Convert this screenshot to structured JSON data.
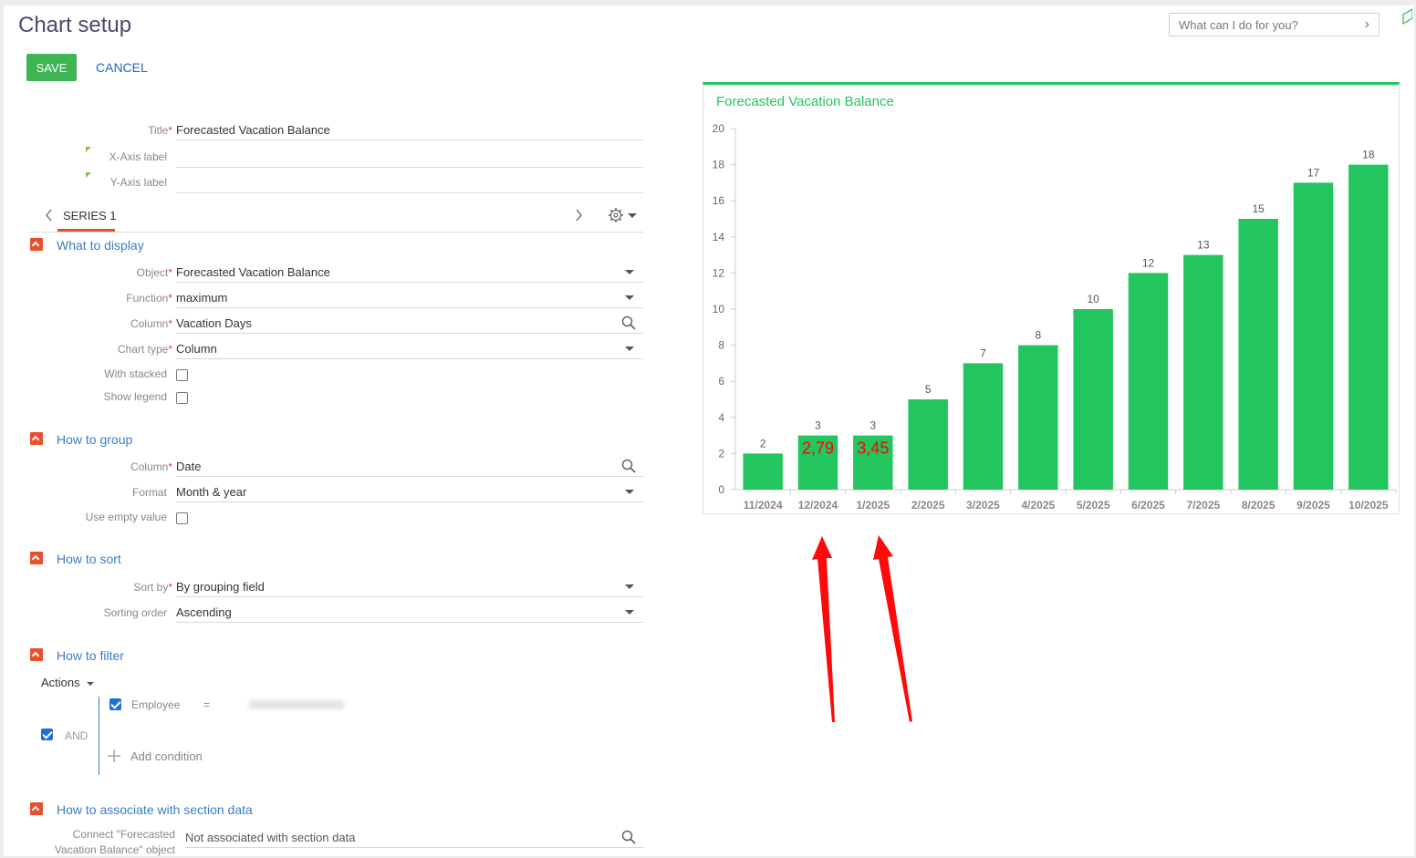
{
  "header": {
    "title": "Chart setup",
    "save_label": "SAVE",
    "cancel_label": "CANCEL",
    "assistant_placeholder": "What can I do for you?"
  },
  "form": {
    "title": {
      "label": "Title",
      "value": "Forecasted Vacation Balance"
    },
    "x_axis": {
      "label": "X-Axis label",
      "value": ""
    },
    "y_axis": {
      "label": "Y-Axis label",
      "value": ""
    },
    "series_tab": "SERIES 1"
  },
  "sections": {
    "display": {
      "title": "What to display",
      "object": {
        "label": "Object",
        "value": "Forecasted Vacation Balance"
      },
      "function": {
        "label": "Function",
        "value": "maximum"
      },
      "column": {
        "label": "Column",
        "value": "Vacation Days"
      },
      "chart_type": {
        "label": "Chart type",
        "value": "Column"
      },
      "with_stacked": "With stacked",
      "show_legend": "Show legend"
    },
    "group": {
      "title": "How to group",
      "column": {
        "label": "Column",
        "value": "Date"
      },
      "format": {
        "label": "Format",
        "value": "Month & year"
      },
      "empty_value": "Use empty value"
    },
    "sort": {
      "title": "How to sort",
      "sort_by": {
        "label": "Sort by",
        "value": "By grouping field"
      },
      "order": {
        "label": "Sorting order",
        "value": "Ascending"
      }
    },
    "filter": {
      "title": "How to filter",
      "actions": "Actions",
      "employee": "Employee",
      "operator": "=",
      "and": "AND",
      "add_condition": "Add condition"
    },
    "associate": {
      "title": "How to associate with section data",
      "label_line1": "Connect \"Forecasted",
      "label_line2": "Vacation Balance\" object",
      "value": "Not associated with section data"
    }
  },
  "colors": {
    "accent": "#22c55e",
    "save": "#3eb453",
    "link": "#3b7dc4",
    "collapse": "#e8502d",
    "annotation": "#ff0000"
  },
  "chart_data": {
    "type": "bar",
    "title": "Forecasted Vacation Balance",
    "xlabel": "",
    "ylabel": "",
    "categories": [
      "11/2024",
      "12/2024",
      "1/2025",
      "2/2025",
      "3/2025",
      "4/2025",
      "5/2025",
      "6/2025",
      "7/2025",
      "8/2025",
      "9/2025",
      "10/2025"
    ],
    "values": [
      2,
      3,
      3,
      5,
      7,
      8,
      10,
      12,
      13,
      15,
      17,
      18
    ],
    "ylim": [
      0,
      20
    ],
    "yticks": [
      0,
      2,
      4,
      6,
      8,
      10,
      12,
      14,
      16,
      18,
      20
    ],
    "grid": false,
    "legend": "none",
    "annotations": [
      {
        "category": "12/2024",
        "text": "2,79"
      },
      {
        "category": "1/2025",
        "text": "3,45"
      }
    ]
  }
}
